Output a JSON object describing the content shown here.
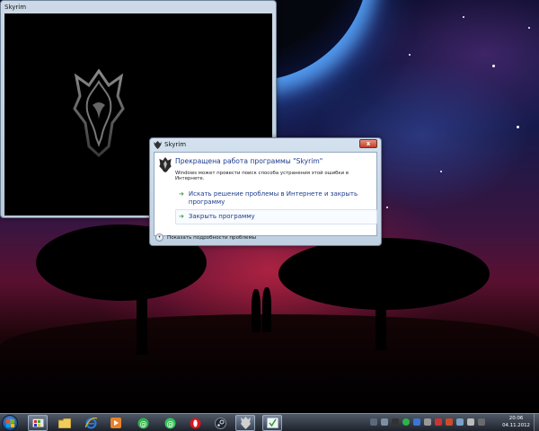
{
  "game_window": {
    "title": "Skyrim"
  },
  "dialog": {
    "title": "Skyrim",
    "close_label": "x",
    "heading": "Прекращена работа программы \"Skyrim\"",
    "subtext": "Windows может провести поиск способа устранения этой ошибки в Интернете.",
    "option_search": "Искать решение проблемы в Интернете и закрыть программу",
    "option_close": "Закрыть программу",
    "details_label": "Показать подробности проблемы"
  },
  "taskbar": {
    "clock_time": "20:06",
    "clock_date": "04.11.2012",
    "pinned_icons": [
      "explorer-icon",
      "media-player-icon",
      "folder-icon",
      "internet-explorer-icon",
      "media-play-icon",
      "icq-icon",
      "icq-icon-2",
      "opera-icon",
      "steam-icon",
      "skyrim-icon",
      "error-reporting-icon"
    ]
  },
  "colors": {
    "link_blue": "#1c3c8c",
    "arrow_green": "#2b9a2b",
    "close_red": "#c2402a",
    "taskbar_dark": "#1f2530"
  }
}
